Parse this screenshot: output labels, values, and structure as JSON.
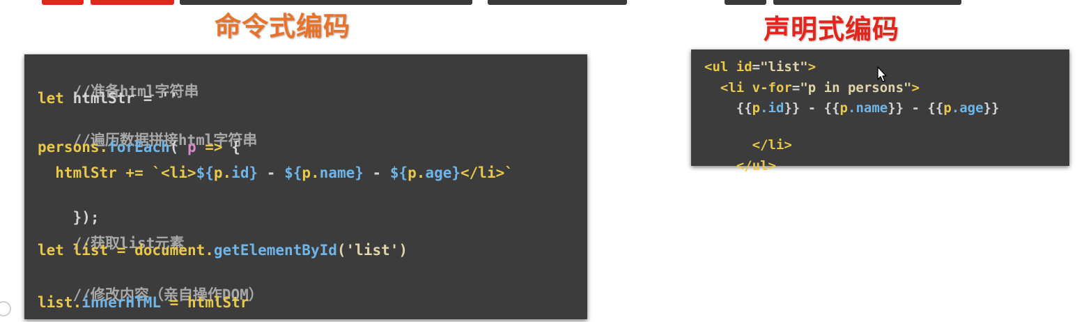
{
  "headings": {
    "imperative": "命令式编码",
    "declarative": "声明式编码"
  },
  "colors": {
    "imperative_heading": "#E8742B",
    "declarative_heading": "#E2261C",
    "code_background": "#3C3C3C",
    "keyword": "#E8C84A",
    "comment": "#A8A8A8",
    "function": "#6FB5E8",
    "string": "#E0D4A8"
  },
  "imperative_code": {
    "l1": "//准备html字符串",
    "l2": {
      "kw": "let",
      "rest": " htmlStr = ''"
    },
    "l3": "//遍历数据拼接html字符串",
    "l4": {
      "obj": "persons.",
      "fn": "forEach",
      "open": "( ",
      "param": "p",
      "arrow": " =>",
      "brace": " {"
    },
    "l5": {
      "indent": "  htmlStr += `<li>",
      "d1": "${",
      "a": "p.",
      "b": "id",
      "c": "}",
      "sep1": " - ",
      "d2": "${",
      "e": "p.",
      "f": "name",
      "g": "}",
      "sep2": " - ",
      "d3": "${",
      "h": "p.",
      "i": "age",
      "j": "}",
      "end": "</li>`"
    },
    "l6": "});",
    "l7": "//获取list元素",
    "l8": {
      "kw": "let",
      "mid": " list = document.",
      "fn": "getElementById",
      "arg": "('list')"
    },
    "l9": "//修改内容（亲自操作DOM）",
    "l10": {
      "obj": "list.",
      "prop": "innerHTML",
      "rest": " = htmlStr"
    }
  },
  "declarative_code": {
    "l1": {
      "open": "<ul ",
      "attr": "id",
      "eq": "=",
      "val": "\"list\"",
      "close": ">"
    },
    "l2": {
      "indent": "  ",
      "open": "<li ",
      "attr": "v-for",
      "eq": "=",
      "val": "\"p in persons\"",
      "close": ">"
    },
    "l3": {
      "indent": "    ",
      "o1": "{{",
      "p1": "p",
      "d1": ".id",
      "c1": "}}",
      "s1": " - ",
      "o2": "{{",
      "p2": "p",
      "d2": ".name",
      "c2": "}}",
      "s2": " - ",
      "o3": "{{",
      "p3": "p",
      "d3": ".age",
      "c3": "}}"
    },
    "l4": "  </li>",
    "l5": "</ul>"
  },
  "icons": {
    "cursor": "mouse-pointer-icon",
    "corner": "circle-mark-icon"
  }
}
